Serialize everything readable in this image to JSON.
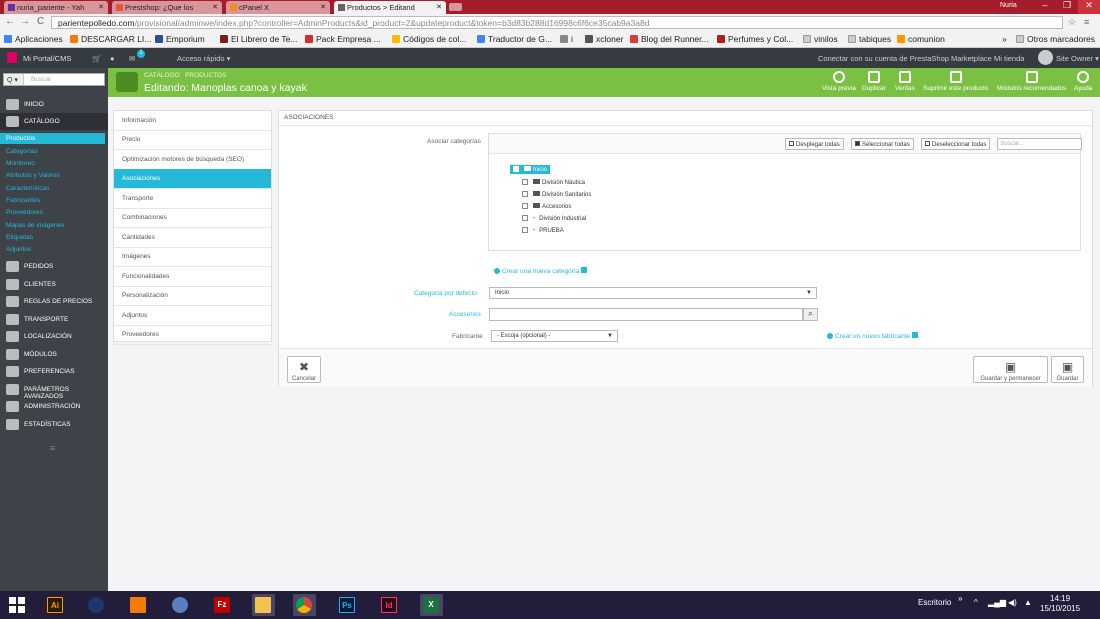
{
  "browser": {
    "tabs": [
      {
        "label": "nuria_pariente - Yah",
        "active": false
      },
      {
        "label": "Prestshop: ¿Que los",
        "active": false
      },
      {
        "label": "cPanel X",
        "active": false
      },
      {
        "label": "Productos > Editand",
        "active": true
      }
    ],
    "user": "Nuria",
    "url_host": "parientepolledo.com",
    "url_path": "/provisional/adminwe/index.php?controller=AdminProducts&id_product=2&updateproduct&token=b3d83b288d16998c6f6ce35cab9a3a8d",
    "bookmarks": [
      "Aplicaciones",
      "DESCARGAR LI...",
      "Emporium",
      "El Librero de Te...",
      "Pack Empresa ...",
      "Códigos de col...",
      "Traductor de G...",
      "i",
      "xcloner",
      "Blog del Runner...",
      "Perfumes y Col...",
      "vinilos",
      "tabiques",
      "comunion",
      "»",
      "Otros marcadores"
    ]
  },
  "header": {
    "site": "Mi Portal/CMS",
    "quick_access": "Acceso rápido ▾",
    "badge": "1",
    "marketplace": "Conectar con su cuenta de PrestaShop Marketplace",
    "my_store": "Mi tienda",
    "owner": "Site Owner ▾"
  },
  "sidebar": {
    "search_placeholder": "Buscar",
    "search_btn": "Q ▾",
    "menu": [
      "Inicio",
      "Catálogo",
      "Pedidos",
      "Clientes",
      "Reglas de precios",
      "Transporte",
      "Localización",
      "Módulos",
      "Preferencias",
      "Parámetros avanzados",
      "Administración",
      "Estadísticas"
    ],
    "catalog_sub": [
      "Productos",
      "Categorías",
      "Monitoreo",
      "Atributos y Valores",
      "Características",
      "Fabricantes",
      "Proveedores",
      "Mapas de imágenes",
      "Etiquetas",
      "Adjuntos"
    ],
    "collapse": "≡"
  },
  "toolbar": {
    "breadcrumb1": "CATÁLOGO",
    "breadcrumb2": "PRODUCTOS",
    "title": "Editando: Manoplas canoa y kayak",
    "buttons": [
      "Vista previa",
      "Duplicar",
      "Ventas",
      "Suprimir este producto",
      "Módulos recomendados",
      "Ayuda"
    ]
  },
  "product_tabs": [
    "Información",
    "Precio",
    "Optimización motores de búsqueda (SEO)",
    "Asociaciones",
    "Transporte",
    "Combinaciones",
    "Cantidades",
    "Imágenes",
    "Funcionalidades",
    "Personalización",
    "Adjuntos",
    "Proveedores"
  ],
  "active_tab": "Asociaciones",
  "panel": {
    "heading": "ASOCIACIONES",
    "assoc_label": "Asociar categorías",
    "tree_buttons": [
      "Desplegar todas",
      "Seleccionar todas",
      "Deseleccionar todas"
    ],
    "tree_search": "buscar...",
    "tree": {
      "root": "Inicio",
      "children": [
        "División Náutica",
        "División Sanitarios",
        "Accesorios",
        "División Industrial",
        "PRUEBA"
      ]
    },
    "create_category": "Crear una nueva categoría",
    "default_cat_label": "Categoría por defecto",
    "default_cat_value": "Inicio",
    "accessories_label": "Accesorios",
    "manufacturer_label": "Fabricante",
    "manufacturer_value": "- Escoja (opcional) -",
    "create_manufacturer": "Crear un nuevo fabricante",
    "cancel": "Cancelar",
    "save_stay": "Guardar y permanecer",
    "save": "Guardar"
  },
  "taskbar": {
    "apps": [
      "Ai",
      "",
      "",
      "",
      "Fz",
      "",
      "",
      "Ps",
      "Id",
      "X"
    ],
    "desktop": "Escritorio",
    "time": "14:19",
    "date": "15/10/2015"
  }
}
